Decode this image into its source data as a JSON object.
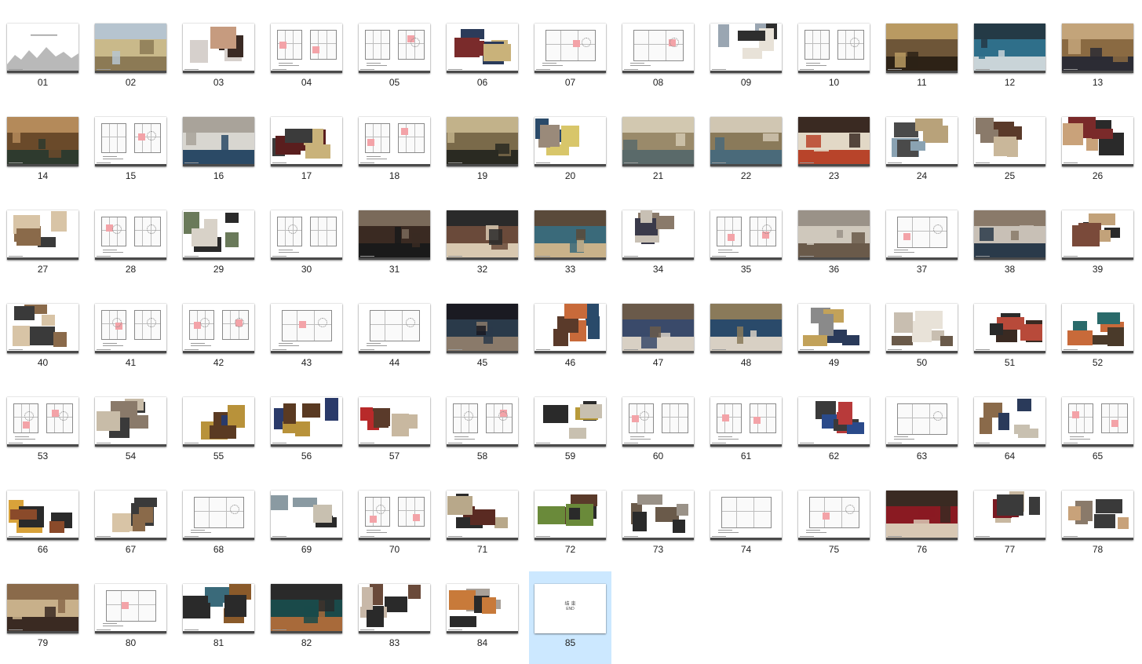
{
  "window": {
    "view": "large-icons"
  },
  "selected_item": "85",
  "colors": {
    "selection": "#cce8ff",
    "label_text": "#222222",
    "plan_highlight": "#f3a3a8",
    "footer_bar": "#4a4a4a"
  },
  "items": [
    {
      "label": "01",
      "type": "ink"
    },
    {
      "label": "02",
      "type": "photo",
      "palette": [
        "#c9b98a",
        "#8c7a55",
        "#b6c4cf"
      ]
    },
    {
      "label": "03",
      "type": "board",
      "palette": [
        "#3a2a24",
        "#c69b7f",
        "#d6d0cc"
      ]
    },
    {
      "label": "04",
      "type": "plan"
    },
    {
      "label": "05",
      "type": "plan"
    },
    {
      "label": "06",
      "type": "board",
      "palette": [
        "#2b3b5a",
        "#7a2b2b",
        "#c9b27a"
      ]
    },
    {
      "label": "07",
      "type": "plan"
    },
    {
      "label": "08",
      "type": "plan"
    },
    {
      "label": "09",
      "type": "board",
      "palette": [
        "#2e2e2e",
        "#9aa6b2",
        "#e8e2d8"
      ]
    },
    {
      "label": "10",
      "type": "plan"
    },
    {
      "label": "11",
      "type": "photo",
      "palette": [
        "#6e5638",
        "#2d2216",
        "#b99a62"
      ]
    },
    {
      "label": "12",
      "type": "photo",
      "palette": [
        "#2f6f8a",
        "#c9d4d8",
        "#243a46"
      ]
    },
    {
      "label": "13",
      "type": "photo",
      "palette": [
        "#8a6a42",
        "#2c2c34",
        "#c3a47a"
      ]
    },
    {
      "label": "14",
      "type": "photo",
      "palette": [
        "#6a4a2a",
        "#2e3a2e",
        "#b48a5a"
      ]
    },
    {
      "label": "15",
      "type": "plan"
    },
    {
      "label": "16",
      "type": "photo",
      "palette": [
        "#d8d6d0",
        "#2b4a66",
        "#a9a39a"
      ]
    },
    {
      "label": "17",
      "type": "board",
      "palette": [
        "#5a1e1e",
        "#c9b27a",
        "#3b3b3b"
      ]
    },
    {
      "label": "18",
      "type": "plan"
    },
    {
      "label": "19",
      "type": "photo",
      "palette": [
        "#7a6a4a",
        "#2a2a22",
        "#c2b28a"
      ]
    },
    {
      "label": "20",
      "type": "board",
      "palette": [
        "#2a4a6a",
        "#d8c66a",
        "#9a8a7a"
      ]
    },
    {
      "label": "21",
      "type": "photo",
      "palette": [
        "#9a8a6a",
        "#5a6a6a",
        "#d2c8b0"
      ]
    },
    {
      "label": "22",
      "type": "photo",
      "palette": [
        "#8a7a5a",
        "#4a6a7a",
        "#d0c6b2"
      ]
    },
    {
      "label": "23",
      "type": "photo",
      "palette": [
        "#e2d8c6",
        "#b8442a",
        "#3a2a22"
      ]
    },
    {
      "label": "24",
      "type": "board",
      "palette": [
        "#4a4a4a",
        "#b8a27a",
        "#8aa2b2"
      ]
    },
    {
      "label": "25",
      "type": "board",
      "palette": [
        "#5a3a2a",
        "#c9b79a",
        "#8a7a6a"
      ]
    },
    {
      "label": "26",
      "type": "board",
      "palette": [
        "#2a2a2a",
        "#c9a27a",
        "#7a2a2a"
      ]
    },
    {
      "label": "27",
      "type": "board",
      "palette": [
        "#d8c4a6",
        "#3a3a3a",
        "#8a6a4a"
      ]
    },
    {
      "label": "28",
      "type": "plan"
    },
    {
      "label": "29",
      "type": "board",
      "palette": [
        "#2a2a2a",
        "#6a7a5a",
        "#d8d2c8"
      ]
    },
    {
      "label": "30",
      "type": "plan"
    },
    {
      "label": "31",
      "type": "photo",
      "palette": [
        "#3a2a22",
        "#1a1a1a",
        "#7a6a5a"
      ]
    },
    {
      "label": "32",
      "type": "photo",
      "palette": [
        "#6a4a3a",
        "#d8c8b0",
        "#2a2a2a"
      ]
    },
    {
      "label": "33",
      "type": "photo",
      "palette": [
        "#3a6a7a",
        "#c9b28a",
        "#5a4a3a"
      ]
    },
    {
      "label": "34",
      "type": "board",
      "palette": [
        "#3a3a4a",
        "#8a7a6a",
        "#c8c0b4"
      ]
    },
    {
      "label": "35",
      "type": "plan"
    },
    {
      "label": "36",
      "type": "photo",
      "palette": [
        "#cfc8bc",
        "#6a5a4a",
        "#9a9288"
      ]
    },
    {
      "label": "37",
      "type": "plan"
    },
    {
      "label": "38",
      "type": "photo",
      "palette": [
        "#c8c0b6",
        "#2a3a4a",
        "#8a7a6a"
      ]
    },
    {
      "label": "39",
      "type": "board",
      "palette": [
        "#2a2a2a",
        "#c2a27a",
        "#7a4a3a"
      ]
    },
    {
      "label": "40",
      "type": "board",
      "palette": [
        "#d8c4a6",
        "#3a3a3a",
        "#8a6a4a"
      ]
    },
    {
      "label": "41",
      "type": "plan"
    },
    {
      "label": "42",
      "type": "plan"
    },
    {
      "label": "43",
      "type": "plan"
    },
    {
      "label": "44",
      "type": "plan"
    },
    {
      "label": "45",
      "type": "photo",
      "palette": [
        "#2a3a4a",
        "#8a7a6a",
        "#1a1a22"
      ]
    },
    {
      "label": "46",
      "type": "board",
      "palette": [
        "#2a4a6a",
        "#c86a3a",
        "#5a3a2a"
      ]
    },
    {
      "label": "47",
      "type": "photo",
      "palette": [
        "#3a4a6a",
        "#d8d0c4",
        "#6a5a4a"
      ]
    },
    {
      "label": "48",
      "type": "photo",
      "palette": [
        "#2a4a6a",
        "#d8d0c4",
        "#8a7a5a"
      ]
    },
    {
      "label": "49",
      "type": "board",
      "palette": [
        "#2a3a5a",
        "#8a8a8a",
        "#c2a25a"
      ]
    },
    {
      "label": "50",
      "type": "board",
      "palette": [
        "#c8beb0",
        "#6a5a4a",
        "#e8e2d8"
      ]
    },
    {
      "label": "51",
      "type": "board",
      "palette": [
        "#3a2a22",
        "#b84a3a",
        "#2a2a2a"
      ]
    },
    {
      "label": "52",
      "type": "board",
      "palette": [
        "#2a6a6a",
        "#c86a3a",
        "#4a3a2a"
      ]
    },
    {
      "label": "53",
      "type": "plan"
    },
    {
      "label": "54",
      "type": "board",
      "palette": [
        "#8a7a6a",
        "#3a3a3a",
        "#c8bca8"
      ]
    },
    {
      "label": "55",
      "type": "board",
      "palette": [
        "#2a3a6a",
        "#b8923a",
        "#5a3a22"
      ]
    },
    {
      "label": "56",
      "type": "board",
      "palette": [
        "#2a3a6a",
        "#b8923a",
        "#5a3a22"
      ]
    },
    {
      "label": "57",
      "type": "board",
      "palette": [
        "#5a3a2a",
        "#b82a2a",
        "#c8b8a0"
      ]
    },
    {
      "label": "58",
      "type": "plan"
    },
    {
      "label": "59",
      "type": "board",
      "palette": [
        "#b89a3a",
        "#2a2a2a",
        "#c8c0b0"
      ]
    },
    {
      "label": "60",
      "type": "plan"
    },
    {
      "label": "61",
      "type": "plan"
    },
    {
      "label": "62",
      "type": "board",
      "palette": [
        "#3a3a3a",
        "#2a4a8a",
        "#b83a3a"
      ]
    },
    {
      "label": "63",
      "type": "plan"
    },
    {
      "label": "64",
      "type": "board",
      "palette": [
        "#2a3a5a",
        "#8a6a4a",
        "#c8c0b0"
      ]
    },
    {
      "label": "65",
      "type": "plan"
    },
    {
      "label": "66",
      "type": "board",
      "palette": [
        "#d8a23a",
        "#2a2a2a",
        "#8a4a2a"
      ]
    },
    {
      "label": "67",
      "type": "board",
      "palette": [
        "#d8c4a6",
        "#3a3a3a",
        "#8a6a4a"
      ]
    },
    {
      "label": "68",
      "type": "plan"
    },
    {
      "label": "69",
      "type": "board",
      "palette": [
        "#2a2a2a",
        "#8a9aa2",
        "#c8c0b0"
      ]
    },
    {
      "label": "70",
      "type": "plan"
    },
    {
      "label": "71",
      "type": "board",
      "palette": [
        "#5a2a22",
        "#2a2a2a",
        "#b8a88a"
      ]
    },
    {
      "label": "72",
      "type": "board",
      "palette": [
        "#5a3a2a",
        "#6a8a3a",
        "#2a2a2a"
      ]
    },
    {
      "label": "73",
      "type": "board",
      "palette": [
        "#6a5a4a",
        "#9a9288",
        "#2a2a2a"
      ]
    },
    {
      "label": "74",
      "type": "plan"
    },
    {
      "label": "75",
      "type": "plan"
    },
    {
      "label": "76",
      "type": "photo",
      "palette": [
        "#8a1a22",
        "#d8c8b4",
        "#3a2a22"
      ]
    },
    {
      "label": "77",
      "type": "board",
      "palette": [
        "#7a1a22",
        "#c8b8a0",
        "#3a3a3a"
      ]
    },
    {
      "label": "78",
      "type": "board",
      "palette": [
        "#3a3a3a",
        "#8a7a6a",
        "#c8a27a"
      ]
    },
    {
      "label": "79",
      "type": "photo",
      "palette": [
        "#c8b08a",
        "#3a2a22",
        "#8a6a4a"
      ]
    },
    {
      "label": "80",
      "type": "plan"
    },
    {
      "label": "81",
      "type": "board",
      "palette": [
        "#3a6a7a",
        "#8a5a2a",
        "#2a2a2a"
      ]
    },
    {
      "label": "82",
      "type": "photo",
      "palette": [
        "#1a4a4a",
        "#a86a3a",
        "#2a2a2a"
      ]
    },
    {
      "label": "83",
      "type": "board",
      "palette": [
        "#6a4a3a",
        "#2a2a2a",
        "#c8b8a8"
      ]
    },
    {
      "label": "84",
      "type": "board",
      "palette": [
        "#2a2a2a",
        "#a8a098",
        "#c87a3a"
      ]
    },
    {
      "label": "85",
      "type": "end",
      "caption_top": "结 束",
      "caption_bottom": "END"
    }
  ]
}
